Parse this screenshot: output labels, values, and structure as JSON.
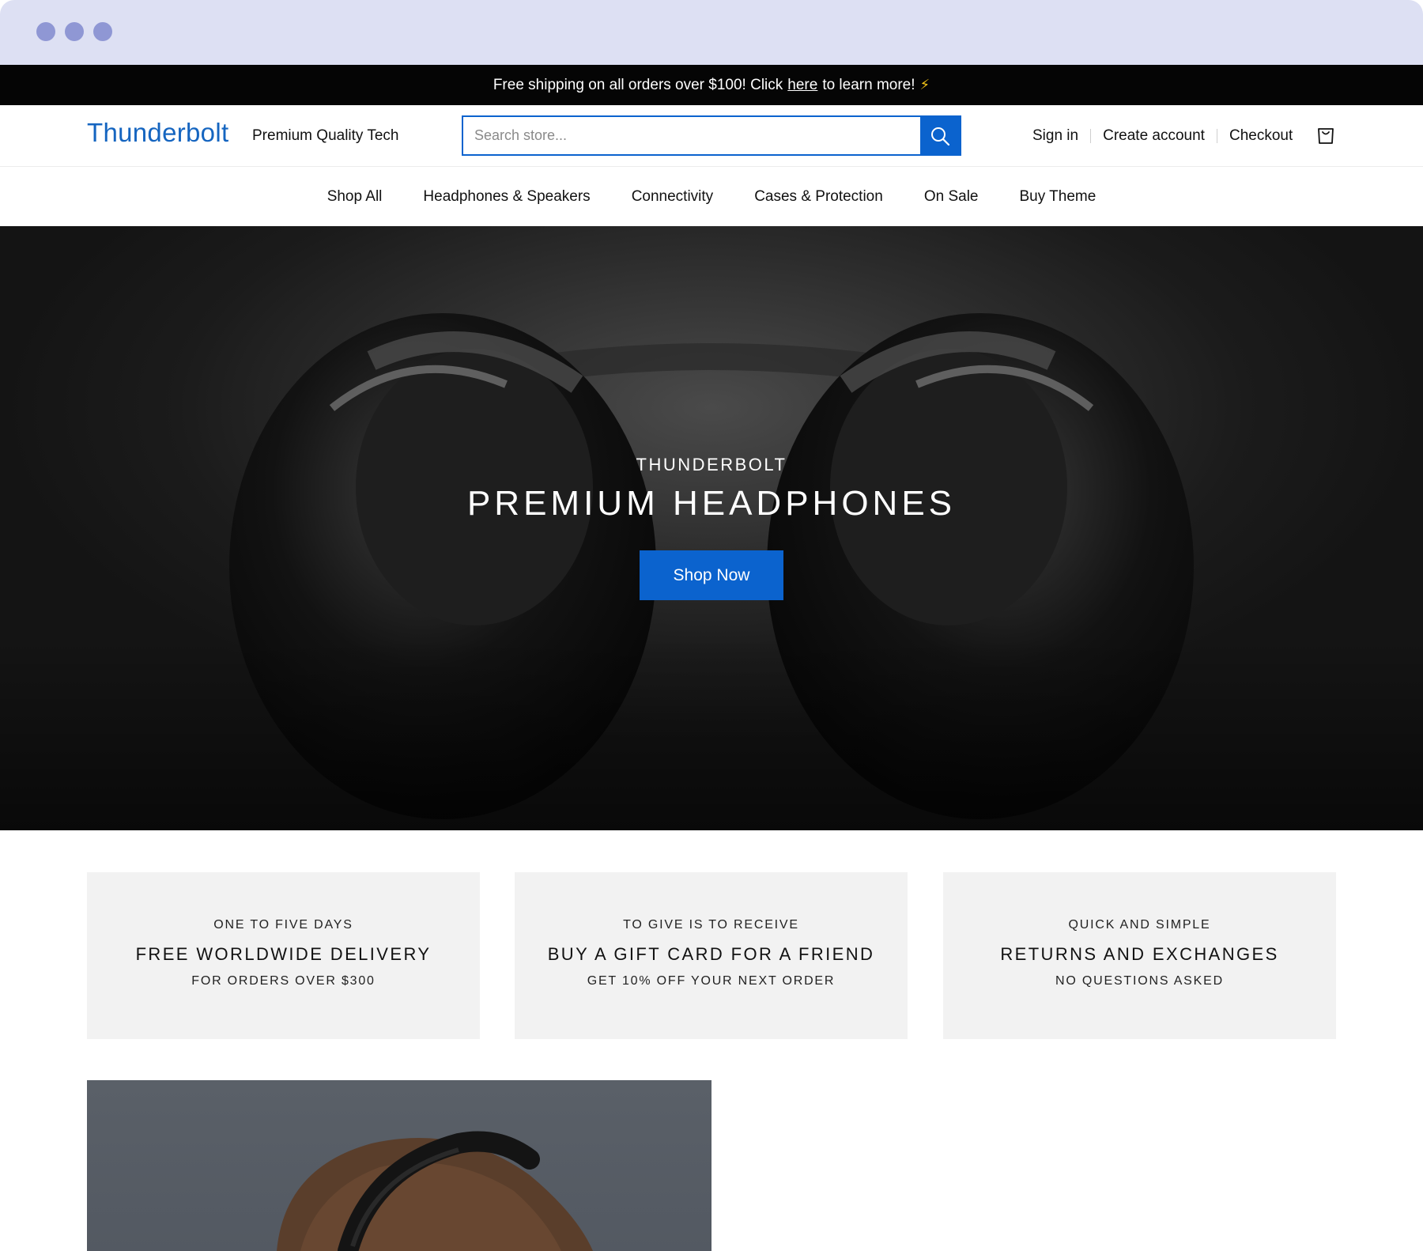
{
  "announcement": {
    "prefix": "Free shipping on all orders over $100! Click",
    "link": "here",
    "suffix": "to learn more!",
    "icon": "lightning-bolt-icon",
    "icon_glyph": "⚡"
  },
  "header": {
    "logo": "Thunderbolt",
    "tagline": "Premium Quality Tech",
    "search_placeholder": "Search store...",
    "account_links": [
      "Sign in",
      "Create account",
      "Checkout"
    ]
  },
  "nav": {
    "items": [
      "Shop All",
      "Headphones & Speakers",
      "Connectivity",
      "Cases & Protection",
      "On Sale",
      "Buy Theme"
    ]
  },
  "hero": {
    "subtitle": "THUNDERBOLT",
    "title": "PREMIUM HEADPHONES",
    "button": "Shop Now"
  },
  "features": [
    {
      "kicker": "ONE TO FIVE DAYS",
      "title": "FREE WORLDWIDE DELIVERY",
      "sub": "FOR ORDERS OVER $300"
    },
    {
      "kicker": "TO GIVE IS TO RECEIVE",
      "title": "BUY A GIFT CARD FOR A FRIEND",
      "sub": "GET 10% OFF YOUR NEXT ORDER"
    },
    {
      "kicker": "QUICK AND SIMPLE",
      "title": "RETURNS AND EXCHANGES",
      "sub": "NO QUESTIONS ASKED"
    }
  ],
  "colors": {
    "brand": "#1565c0",
    "accent": "#0b63ce",
    "announcement_bg": "#050505",
    "chrome": "#dde0f3",
    "card_bg": "#f2f2f2"
  }
}
